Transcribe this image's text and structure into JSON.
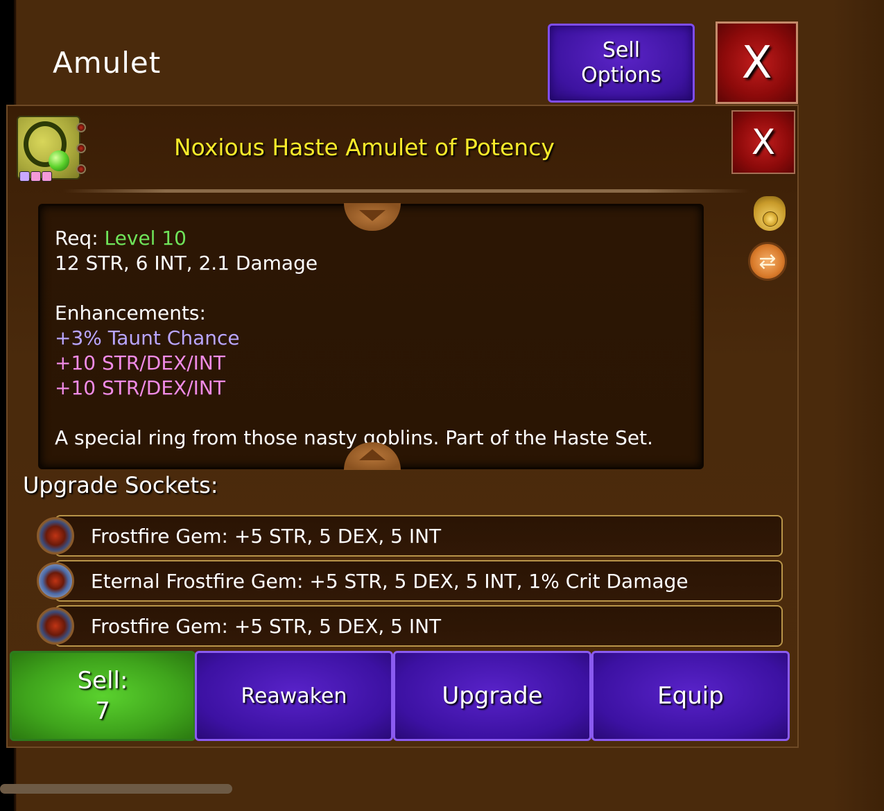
{
  "header": {
    "title": "Amulet",
    "sell_options_label": "Sell\nOptions",
    "close_label": "X"
  },
  "item": {
    "name": "Noxious Haste Amulet of Potency",
    "close_label": "X",
    "icon": "amulet-icon",
    "socket_pips": [
      "#c9a8ff",
      "#f59ad8",
      "#f59ad8"
    ]
  },
  "description": {
    "req_prefix": "Req:",
    "req_level": "Level 10",
    "stats": "12 STR, 6 INT, 2.1 Damage",
    "enhancements_heading": "Enhancements:",
    "enhancements": [
      {
        "text": "+3% Taunt Chance",
        "color": "#b9a6ff"
      },
      {
        "text": "+10 STR/DEX/INT",
        "color": "#f08be6"
      },
      {
        "text": "+10 STR/DEX/INT",
        "color": "#f08be6"
      }
    ],
    "flavor": "A special ring from those nasty goblins. Part of the Haste Set."
  },
  "sockets": {
    "heading": "Upgrade Sockets:",
    "items": [
      {
        "label": "Frostfire Gem: +5 STR, 5 DEX, 5 INT",
        "icon": "frostfire-gem-icon"
      },
      {
        "label": "Eternal Frostfire Gem: +5 STR, 5 DEX, 5 INT, 1% Crit Damage",
        "icon": "eternal-frostfire-gem-icon"
      },
      {
        "label": "Frostfire Gem: +5 STR, 5 DEX, 5 INT",
        "icon": "frostfire-gem-icon"
      }
    ]
  },
  "actions": {
    "sell_label": "Sell:",
    "sell_value": "7",
    "reawaken_label": "Reawaken",
    "upgrade_label": "Upgrade",
    "equip_label": "Equip"
  },
  "colors": {
    "item_name": "#f8ea2a",
    "req_level": "#6fe35a",
    "sell_button": "#3fa41c",
    "action_button": "#3c11a2",
    "close_button": "#8d0a0a"
  }
}
